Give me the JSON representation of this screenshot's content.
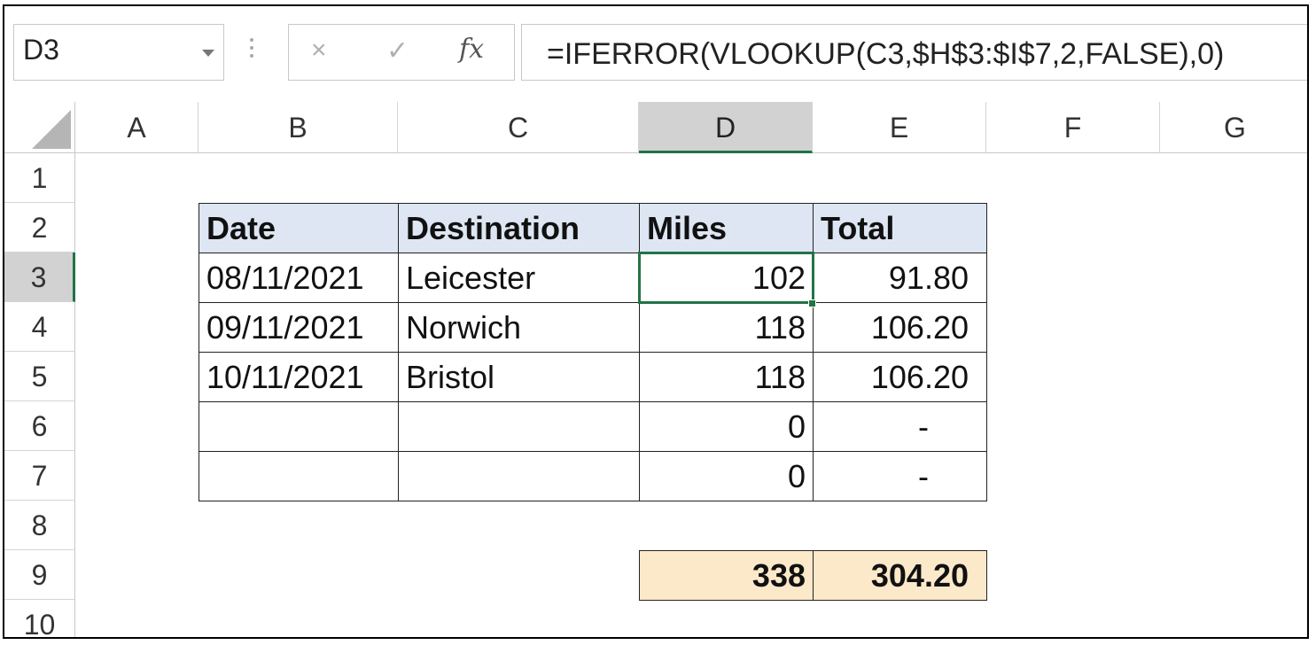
{
  "name_box": {
    "value": "D3"
  },
  "formula_bar": {
    "cancel_icon": "×",
    "enter_icon": "✓",
    "function_icon": "fx",
    "formula": "=IFERROR(VLOOKUP(C3,$H$3:$I$7,2,FALSE),0)"
  },
  "columns": [
    "A",
    "B",
    "C",
    "D",
    "E",
    "F",
    "G"
  ],
  "rows": [
    "1",
    "2",
    "3",
    "4",
    "5",
    "6",
    "7",
    "8",
    "9",
    "10"
  ],
  "selected": {
    "column": "D",
    "row": "3"
  },
  "table": {
    "headers": {
      "date": "Date",
      "destination": "Destination",
      "miles": "Miles",
      "total": "Total"
    },
    "rows": [
      {
        "date": "08/11/2021",
        "destination": "Leicester",
        "miles": "102",
        "total": "91.80"
      },
      {
        "date": "09/11/2021",
        "destination": "Norwich",
        "miles": "118",
        "total": "106.20"
      },
      {
        "date": "10/11/2021",
        "destination": "Bristol",
        "miles": "118",
        "total": "106.20"
      },
      {
        "date": "",
        "destination": "",
        "miles": "0",
        "total": "-"
      },
      {
        "date": "",
        "destination": "",
        "miles": "0",
        "total": "-"
      }
    ],
    "totals": {
      "miles": "338",
      "total": "304.20"
    }
  },
  "colors": {
    "header_fill": "#dde6f2",
    "total_fill": "#fce9ca",
    "selection": "#217346"
  }
}
